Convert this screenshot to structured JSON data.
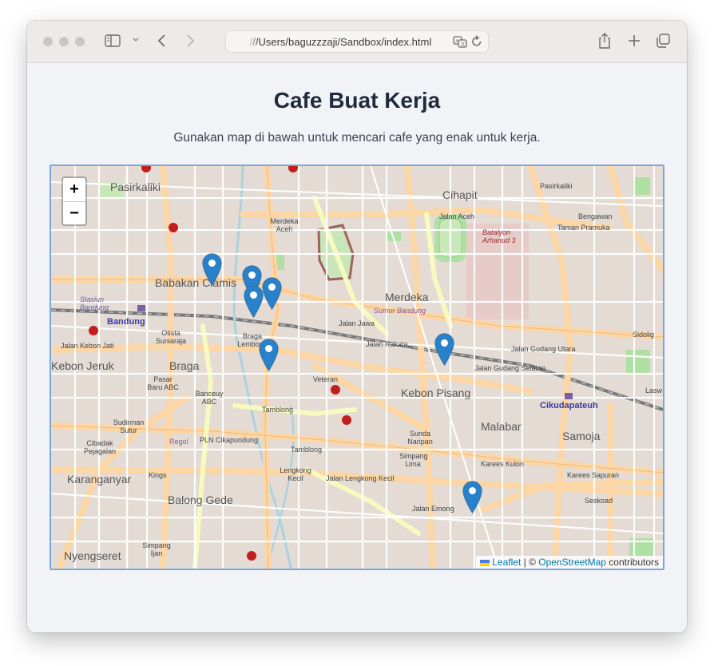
{
  "browser": {
    "url": ":///Users/baguzzzaji/Sandbox/index.html"
  },
  "page": {
    "title": "Cafe Buat Kerja",
    "subtitle": "Gunakan map di bawah untuk mencari cafe yang enak untuk kerja."
  },
  "map": {
    "zoom_in_label": "+",
    "zoom_out_label": "−",
    "attribution": {
      "leaflet": "Leaflet",
      "separator": " | © ",
      "osm": "OpenStreetMap",
      "suffix": " contributors"
    },
    "marker_count": 7,
    "labels": {
      "pasirkaliki": "Pasirkaliki",
      "cihapit": "Cihapit",
      "babakan_ciamis": "Babakan Ciamis",
      "merdeka": "Merdeka",
      "bandung": "Bandung",
      "stasiun_bandung": "Stasiun Bandung",
      "kebon_jeruk": "Kebon Jeruk",
      "braga": "Braga",
      "kebon_pisang": "Kebon Pisang",
      "malabar": "Malabar",
      "samoja": "Samoja",
      "karanganyar": "Karanganyar",
      "balong_gede": "Balong Gede",
      "nyengseret": "Nyengseret",
      "cikudapateuh": "Cikudapateuh",
      "regol": "Regol",
      "batalyon": "Batalyon Arhanud 3",
      "sumur_bandung": "Sumur Bandung",
      "jalan_aceh": "Jalan Aceh",
      "jalan_jawa": "Jalan Jawa",
      "jalan_kebon_jati": "Jalan Kebon Jati",
      "jalan_lengkong_kecil": "Jalan Lengkong Kecil",
      "jalan_gudang_utara": "Jalan Gudang Utara",
      "veteran": "Veteran",
      "tamblong": "Tamblong",
      "karees_kulon": "Karees Kulon",
      "karees_sapuran": "Karees Sapuran",
      "seskoad": "Seskoad",
      "bengawan": "Bengawan",
      "taman_pramuka": "Taman Pramuka",
      "merdeka_aceh": "Merdeka Aceh",
      "jalan_rakata": "Jalan Rakata",
      "jalan_gudang_selatan": "Jalan Gudang Selatan",
      "sudirman_sutur": "Sudirman Sutur",
      "cibadak_pejagalan": "Cibadak Pejagalan",
      "pasar_baru_abc": "Pasar Baru ABC",
      "banceuy_abc": "Banceuy ABC",
      "otista_suniaraja": "Otista Suniaraja",
      "braga_lembong": "Braga Lembong",
      "pln_cikapundung": "PLN Cikapundung",
      "sunda_naripan": "Sunda Naripan",
      "simpang_lima": "Simpang Lima",
      "lengkong_kecil": "Lengkong Kecil",
      "jalan_emong": "Jalan Emong",
      "jalan_sidolig": "Sidolig",
      "kings": "Kings",
      "simpang_ijan": "Simpang Ijan",
      "jalan_laswi": "Lasw"
    }
  },
  "colors": {
    "accent_border": "#7aa6e0",
    "marker": "#2a81cb",
    "link": "#0078a8"
  }
}
